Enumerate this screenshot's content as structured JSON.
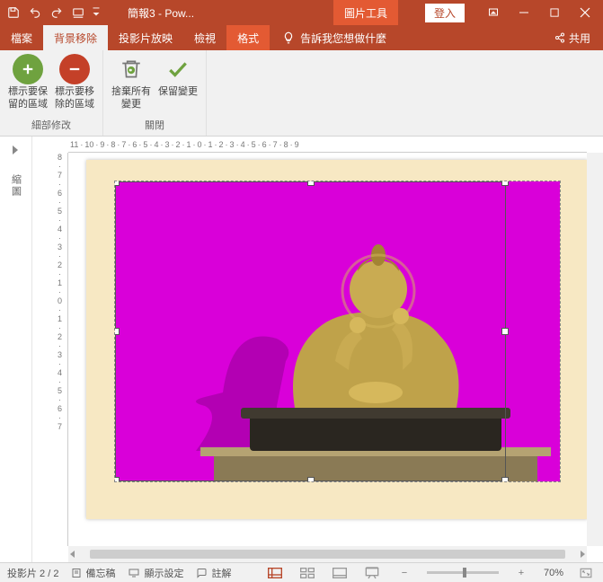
{
  "title": "簡報3 - Pow...",
  "context_tab": "圖片工具",
  "login": "登入",
  "tabs": {
    "file": "檔案",
    "bgremove": "背景移除",
    "slideshow": "投影片放映",
    "view": "檢視",
    "format": "格式"
  },
  "tellme": "告訴我您想做什麼",
  "share": "共用",
  "ribbon": {
    "mark_keep": "標示要保留的區域",
    "mark_remove": "標示要移除的區域",
    "discard": "捨棄所有變更",
    "keep": "保留變更",
    "group_refine": "細部修改",
    "group_close": "關閉"
  },
  "ruler_h": [
    "11",
    "10",
    "9",
    "8",
    "7",
    "6",
    "5",
    "4",
    "3",
    "2",
    "1",
    "0",
    "1",
    "2",
    "3",
    "4",
    "5",
    "6",
    "7",
    "8",
    "9"
  ],
  "ruler_v": [
    "8",
    "7",
    "6",
    "5",
    "4",
    "3",
    "2",
    "1",
    "0",
    "1",
    "2",
    "3",
    "4",
    "5",
    "6",
    "7"
  ],
  "thumb_label": "縮圖",
  "status": {
    "slide": "投影片 2 / 2",
    "notes": "備忘稿",
    "display": "顯示設定",
    "comments": "註解",
    "zoom": "70%"
  }
}
